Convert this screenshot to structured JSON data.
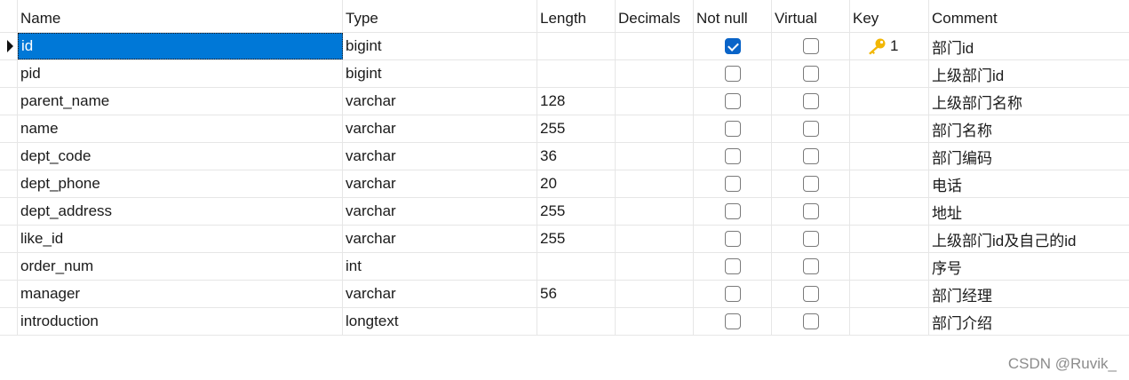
{
  "columns": {
    "name": "Name",
    "type": "Type",
    "length": "Length",
    "decimals": "Decimals",
    "not_null": "Not null",
    "virtual": "Virtual",
    "key": "Key",
    "comment": "Comment"
  },
  "rows": [
    {
      "name": "id",
      "type": "bigint",
      "length": "",
      "decimals": "",
      "not_null": true,
      "virtual": false,
      "key": "1",
      "key_icon": "key-icon",
      "comment": "部门id",
      "selected": true
    },
    {
      "name": "pid",
      "type": "bigint",
      "length": "",
      "decimals": "",
      "not_null": false,
      "virtual": false,
      "key": "",
      "comment": "上级部门id"
    },
    {
      "name": "parent_name",
      "type": "varchar",
      "length": "128",
      "decimals": "",
      "not_null": false,
      "virtual": false,
      "key": "",
      "comment": "上级部门名称"
    },
    {
      "name": "name",
      "type": "varchar",
      "length": "255",
      "decimals": "",
      "not_null": false,
      "virtual": false,
      "key": "",
      "comment": "部门名称"
    },
    {
      "name": "dept_code",
      "type": "varchar",
      "length": "36",
      "decimals": "",
      "not_null": false,
      "virtual": false,
      "key": "",
      "comment": "部门编码"
    },
    {
      "name": "dept_phone",
      "type": "varchar",
      "length": "20",
      "decimals": "",
      "not_null": false,
      "virtual": false,
      "key": "",
      "comment": "电话"
    },
    {
      "name": "dept_address",
      "type": "varchar",
      "length": "255",
      "decimals": "",
      "not_null": false,
      "virtual": false,
      "key": "",
      "comment": "地址"
    },
    {
      "name": "like_id",
      "type": "varchar",
      "length": "255",
      "decimals": "",
      "not_null": false,
      "virtual": false,
      "key": "",
      "comment": "上级部门id及自己的id"
    },
    {
      "name": "order_num",
      "type": "int",
      "length": "",
      "decimals": "",
      "not_null": false,
      "virtual": false,
      "key": "",
      "comment": "序号"
    },
    {
      "name": "manager",
      "type": "varchar",
      "length": "56",
      "decimals": "",
      "not_null": false,
      "virtual": false,
      "key": "",
      "comment": "部门经理"
    },
    {
      "name": "introduction",
      "type": "longtext",
      "length": "",
      "decimals": "",
      "not_null": false,
      "virtual": false,
      "key": "",
      "comment": "部门介绍"
    }
  ],
  "watermark": "CSDN @Ruvik_",
  "colors": {
    "selection": "#0078d7",
    "checkbox_checked": "#0a64c8",
    "key_icon": "#f2b705"
  }
}
